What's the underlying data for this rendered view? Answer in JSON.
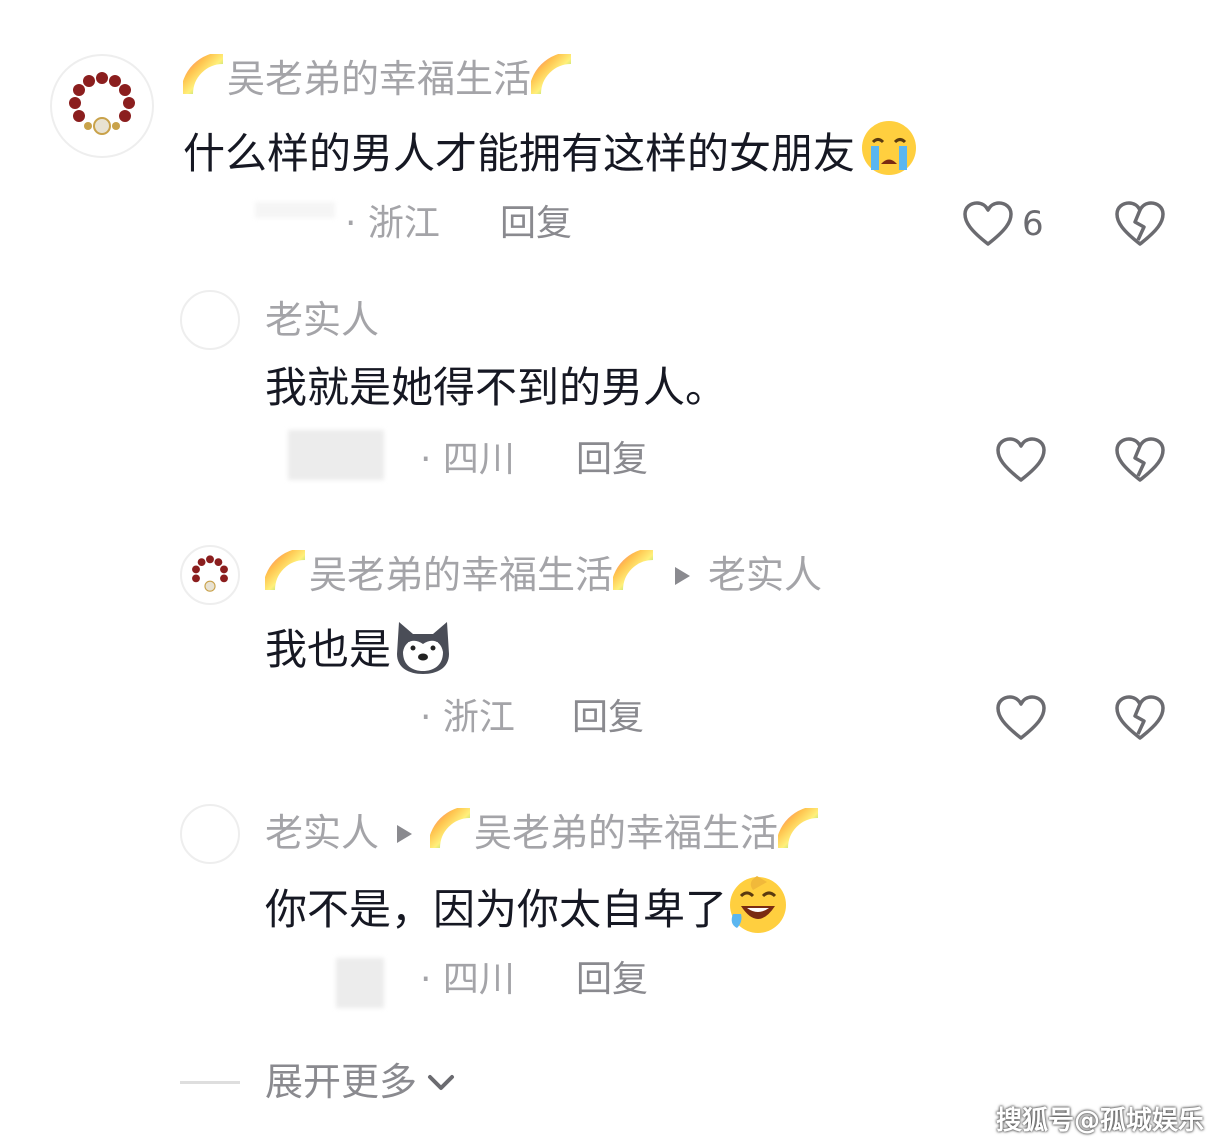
{
  "comments": [
    {
      "user": "吴老弟的幸福生活",
      "text": "什么样的男人才能拥有这样的女朋友",
      "emoji": "crying-face",
      "location": "· 浙江",
      "reply_label": "回复",
      "like_count": "6"
    },
    {
      "user": "老实人",
      "text": "我就是她得不到的男人。",
      "location": "· 四川",
      "reply_label": "回复"
    },
    {
      "user": "吴老弟的幸福生活",
      "reply_to": "老实人",
      "text": "我也是",
      "emoji": "husky-dog-face",
      "location": "· 浙江",
      "reply_label": "回复"
    },
    {
      "user": "老实人",
      "reply_to": "吴老弟的幸福生活",
      "text": "你不是，因为你太自卑了",
      "emoji": "rolling-laughing-face",
      "location": "· 四川",
      "reply_label": "回复"
    }
  ],
  "expand_more_label": "展开更多",
  "watermark": "搜狐号@孤城娱乐",
  "colors": {
    "username": "#a4a4a8",
    "text": "#161823",
    "meta": "#a4a4a8",
    "reply": "#8a8a8f"
  }
}
